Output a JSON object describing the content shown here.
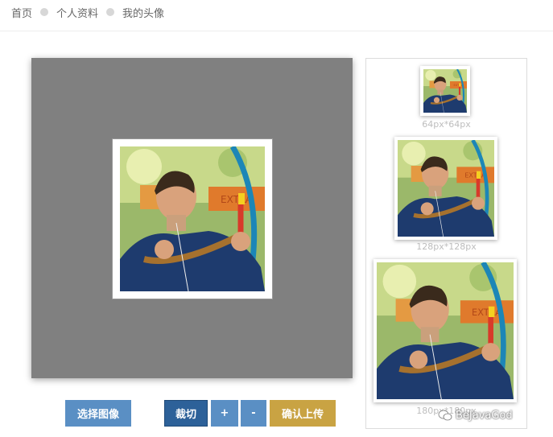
{
  "breadcrumb": {
    "home": "首页",
    "profile": "个人资料",
    "current": "我的头像"
  },
  "previews": [
    {
      "label": "64px*64px"
    },
    {
      "label": "128px*128px"
    },
    {
      "label": "180px*180px"
    }
  ],
  "buttons": {
    "select_image": "选择图像",
    "crop": "裁切",
    "zoom_in": "+",
    "zoom_out": "-",
    "confirm_upload": "确认上传"
  },
  "watermark": {
    "text": "BeJavaGod"
  },
  "colors": {
    "primary": "#5a8fc4",
    "primary_dark": "#2d6199",
    "upload": "#c9a343",
    "stage": "#808080"
  }
}
